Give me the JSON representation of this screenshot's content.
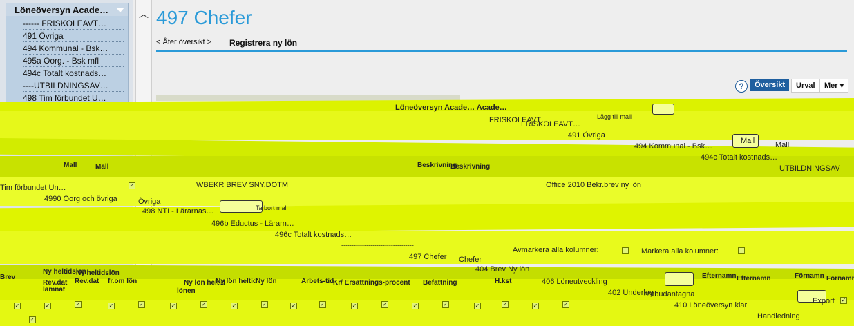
{
  "sidebar": {
    "title": "Löneöversyn Acade…",
    "items": [
      {
        "label": "------ FRISKOLEAVT…"
      },
      {
        "label": "491 Övriga"
      },
      {
        "label": "494 Kommunal - Bsk…"
      },
      {
        "label": "495a Oorg. - Bsk mfl"
      },
      {
        "label": "494c Totalt kostnads…"
      },
      {
        "label": "----UTBILDNINGSAV…"
      },
      {
        "label": "498 Tim förbundet U…"
      }
    ]
  },
  "header": {
    "title": "497 Chefer",
    "back_link": "< Åter översikt >",
    "register_link": "Registrera ny lön"
  },
  "toolbar": {
    "help": "?",
    "oversikt": "Översikt",
    "urval": "Urval",
    "mer": "Mer ▾"
  },
  "glitch": {
    "texts": [
      "Löneöversyn Acade… Acade…",
      "FRISKOLEAVT…",
      "FRISKOLEAVT…",
      "Lägg till mall",
      "491 Övriga",
      "494 Kommunal - Bsk…",
      "Mall",
      "Mall",
      "494c Totalt kostnads…",
      "UTBILDNINGSAV",
      "Mall",
      "Mall",
      "Beskrivning",
      "Beskrivning",
      "WBEKR BREV SNY.DOTM",
      "Office 2010 Bekr.brev ny lön",
      "Tim förbundet Un…",
      "4990 Oorg och övriga",
      "Övriga",
      "Ta bort mall",
      "498 NTI - Lärarnas…",
      "496b Eductus - Lärarn…",
      "496c Totalt kostnads…",
      "-----------------------------------",
      "Avmarkera alla kolumner:",
      "Markera alla kolumner:",
      "497 Chefer",
      "Chefer",
      "Ny heltidslön",
      "Ny heltidslön",
      "404 Brev Ny lön",
      "Brev",
      "Rev.dat",
      "Rev.dat",
      "fr.om lön",
      "Ny lön heltid",
      "Ny lön heltid",
      "Ny lön",
      "Arbets-tid",
      "Kr/ Ersättnings-procent",
      "Befattning",
      "H.kst",
      "406 Löneutveckling",
      "Efternamn",
      "Efternamn",
      "Förnamn",
      "Förnamn",
      "lämnat",
      "lönen",
      "402 Underlag",
      "ombudantagna",
      "410 Löneöversyn klar",
      "Export",
      "Handledning"
    ]
  }
}
